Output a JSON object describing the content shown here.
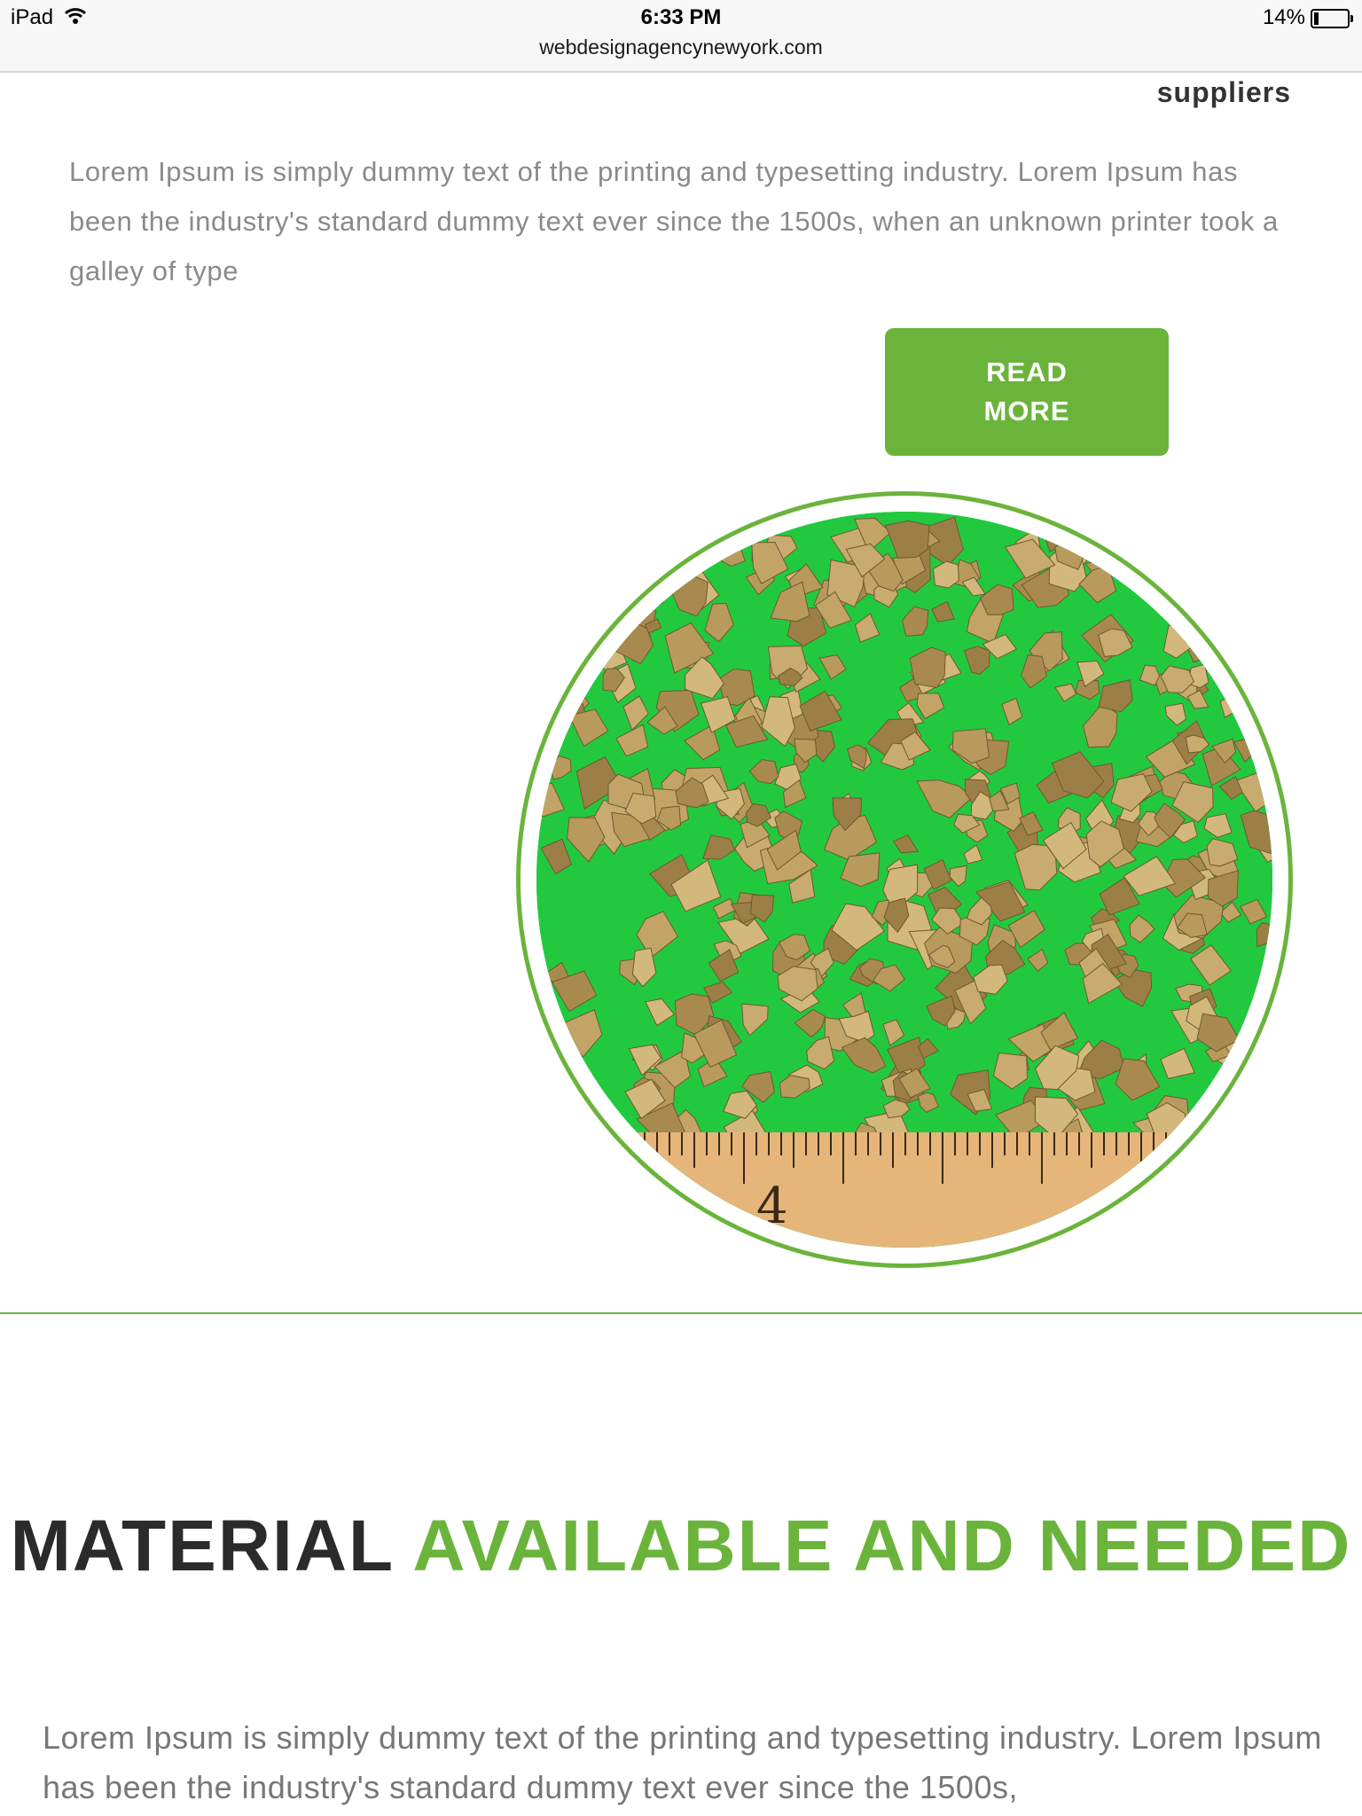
{
  "status_bar": {
    "device": "iPad",
    "time": "6:33 PM",
    "battery": "14%",
    "battery_level": 0.14,
    "url": "webdesignagencynewyork.com"
  },
  "suppliers_heading": "suppliers",
  "intro_text": "Lorem Ipsum is simply dummy text of the printing and typesetting industry. Lorem Ipsum has been the industry's standard dummy text ever since the 1500s, when an unknown printer took a galley of type",
  "read_more": {
    "line1": "READ",
    "line2": "MORE"
  },
  "photo": {
    "ruler_number": "4"
  },
  "section": {
    "title_dark": "MATERIAL",
    "title_green": "AVAILABLE AND NEEDED",
    "body": "Lorem Ipsum is simply dummy text of the printing and typesetting industry. Lorem Ipsum has been the industry's standard dummy text ever since the 1500s,"
  },
  "colors": {
    "accent": "#6bb43c",
    "text_dark": "#2b2b2b",
    "text_muted": "#8a8a8a"
  }
}
